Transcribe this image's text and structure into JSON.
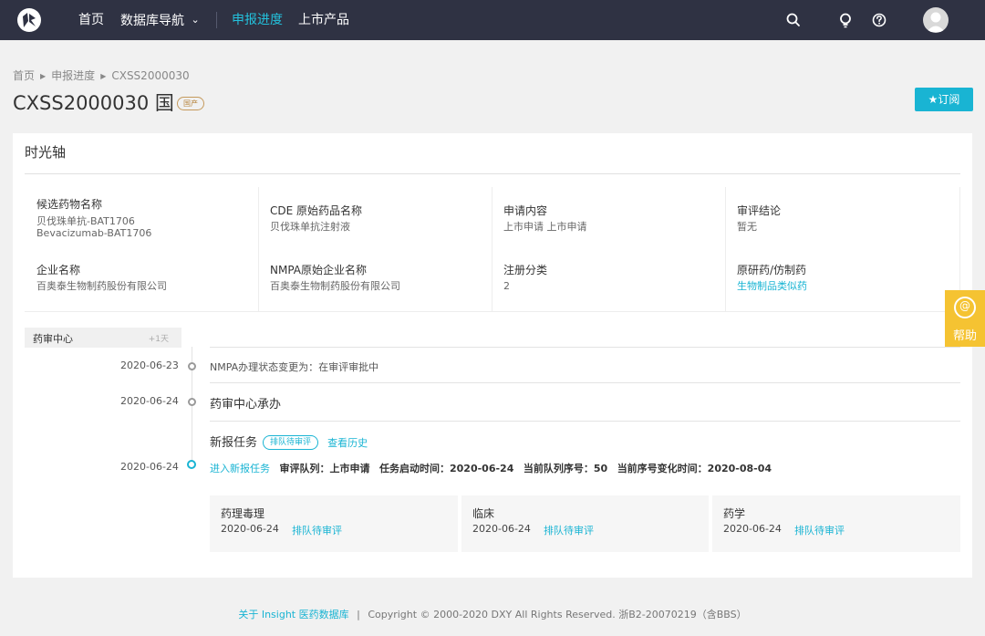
{
  "nav": {
    "home": "首页",
    "db_nav": "数据库导航",
    "db_nav_caret": "⌄",
    "progress": "申报进度",
    "products": "上市产品"
  },
  "breadcrumb": {
    "home": "首页",
    "progress": "申报进度",
    "current": "CXSS2000030"
  },
  "page": {
    "title": "CXSS2000030 国",
    "origin_badge": "国产",
    "subscribe_label": "★订阅"
  },
  "card": {
    "title": "时光轴"
  },
  "info": [
    {
      "label": "候选药物名称",
      "value": "贝伐珠单抗-BAT1706",
      "value2": "Bevacizumab-BAT1706"
    },
    {
      "label": "CDE 原始药品名称",
      "value": "贝伐珠单抗注射液"
    },
    {
      "label": "申请内容",
      "value": "上市申请 上市申请"
    },
    {
      "label": "审评结论",
      "value": "暂无"
    },
    {
      "label": "企业名称",
      "value": "百奥泰生物制药股份有限公司"
    },
    {
      "label": "NMPA原始企业名称",
      "value": "百奥泰生物制药股份有限公司"
    },
    {
      "label": "注册分类",
      "value": "2"
    },
    {
      "label": "原研药/仿制药",
      "value": "生物制品类似药"
    }
  ],
  "timeline": {
    "center": "药审中心",
    "delta": "+1天",
    "events": [
      {
        "date": "2020-06-23",
        "text": "NMPA办理状态变更为：在审评审批中"
      },
      {
        "date": "2020-06-24",
        "text": "药审中心承办"
      },
      {
        "date": "2020-06-24",
        "title": "新报任务",
        "badge": "排队待审评",
        "history": "查看历史"
      }
    ],
    "detail": {
      "enter": "进入新报任务",
      "queue": "审评队列：上市申请",
      "start": "任务启动时间：2020-06-24",
      "seq": "当前队列序号：50",
      "seq_change": "当前序号变化时间：2020-08-04"
    },
    "subtasks": [
      {
        "name": "药理毒理",
        "date": "2020-06-24",
        "status": "排队待审评"
      },
      {
        "name": "临床",
        "date": "2020-06-24",
        "status": "排队待审评"
      },
      {
        "name": "药学",
        "date": "2020-06-24",
        "status": "排队待审评"
      }
    ]
  },
  "help": {
    "icon": "@",
    "label": "帮助"
  },
  "footer": {
    "about": "关于 Insight 医药数据库",
    "sep": "|",
    "copyright": "Copyright © 2000-2020 DXY All Rights Reserved. 浙B2-20070219（含BBS）"
  },
  "colors": {
    "nav_bg": "#2f3243",
    "accent": "#19b4d3",
    "help_bg": "#f5c332"
  }
}
